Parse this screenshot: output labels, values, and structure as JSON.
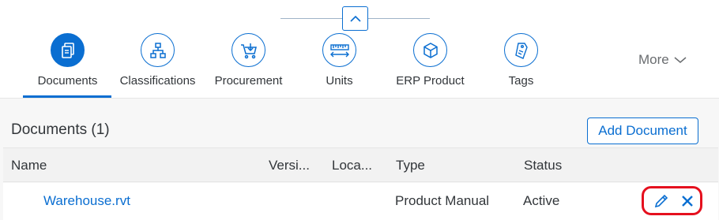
{
  "tabs": [
    {
      "label": "Documents",
      "icon": "documents-icon",
      "selected": true
    },
    {
      "label": "Classifications",
      "icon": "hierarchy-icon",
      "selected": false
    },
    {
      "label": "Procurement",
      "icon": "cart-icon",
      "selected": false
    },
    {
      "label": "Units",
      "icon": "ruler-icon",
      "selected": false
    },
    {
      "label": "ERP Product",
      "icon": "product-icon",
      "selected": false
    },
    {
      "label": "Tags",
      "icon": "tags-icon",
      "selected": false
    }
  ],
  "more": {
    "label": "More"
  },
  "documents": {
    "title": "Documents (1)",
    "add_button": "Add Document",
    "columns": [
      "Name",
      "Versi...",
      "Loca...",
      "Type",
      "Status"
    ],
    "rows": [
      {
        "name": "Warehouse.rvt",
        "version": "",
        "location": "",
        "type": "Product Manual",
        "status": "Active"
      }
    ]
  },
  "colors": {
    "accent": "#0a6ed1",
    "highlight": "#e5101e"
  }
}
